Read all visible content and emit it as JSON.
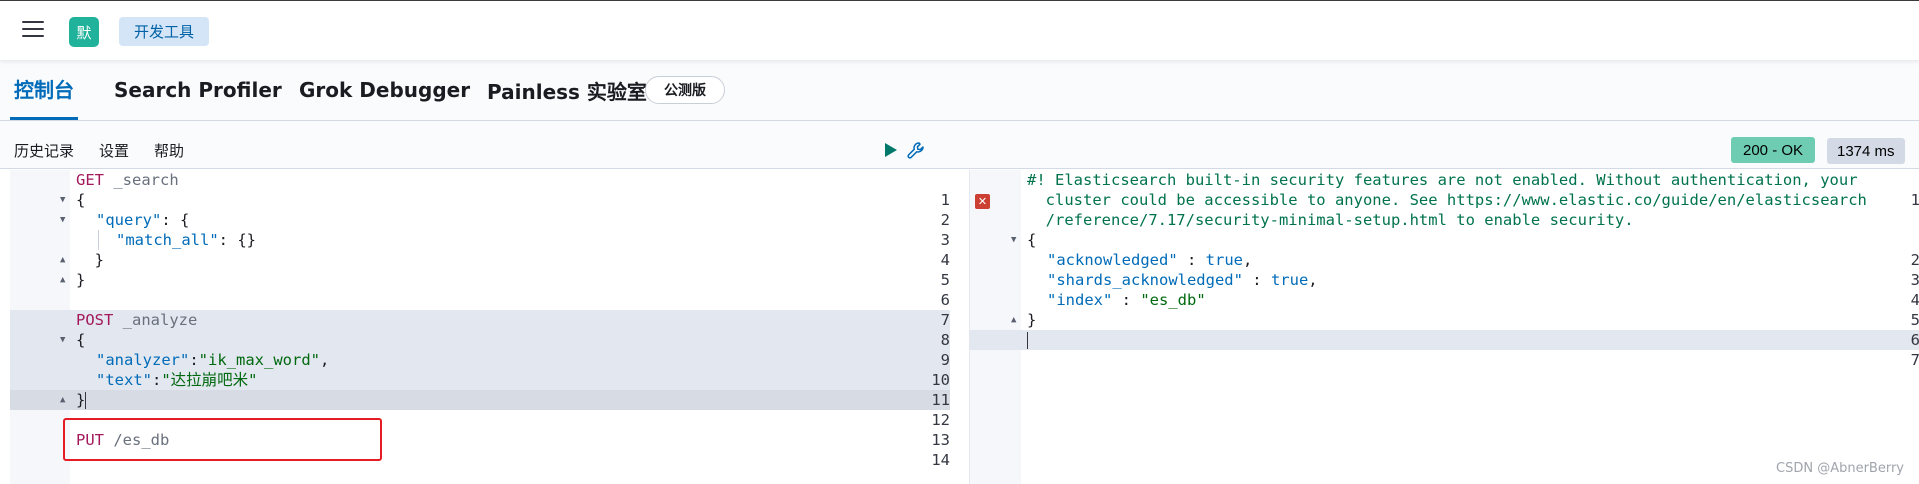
{
  "header": {
    "app_badge": "默",
    "breadcrumb": "开发工具"
  },
  "tabs": [
    {
      "label": "控制台",
      "active": true
    },
    {
      "label": "Search Profiler",
      "active": false
    },
    {
      "label": "Grok Debugger",
      "active": false
    },
    {
      "label": "Painless 实验室",
      "active": false
    }
  ],
  "beta_badge": "公测版",
  "toolbar": {
    "history": "历史记录",
    "settings": "设置",
    "help": "帮助"
  },
  "status": {
    "code": "200 - OK",
    "time": "1374 ms"
  },
  "request_editor": {
    "lines": [
      {
        "n": "1",
        "method": "GET",
        "url": " _search"
      },
      {
        "n": "2",
        "text": "{"
      },
      {
        "n": "3",
        "key": "\"query\"",
        "rest": ": {"
      },
      {
        "n": "4",
        "key": "\"match_all\"",
        "rest": ": {}"
      },
      {
        "n": "5",
        "text": "  }"
      },
      {
        "n": "6",
        "text": "}"
      },
      {
        "n": "7",
        "text": ""
      },
      {
        "n": "8",
        "method": "POST",
        "url": " _analyze"
      },
      {
        "n": "9",
        "text": "{"
      },
      {
        "n": "10",
        "key": "\"analyzer\"",
        "sep": ":",
        "str": "\"ik_max_word\"",
        "tail": ","
      },
      {
        "n": "11",
        "key": "\"text\"",
        "sep": ":",
        "str": "\"达拉崩吧米\""
      },
      {
        "n": "12",
        "text": "}"
      },
      {
        "n": "13",
        "text": ""
      },
      {
        "n": "14",
        "method": "PUT",
        "url": " /es_db"
      }
    ]
  },
  "response_editor": {
    "comment_lines": [
      "#! Elasticsearch built-in security features are not enabled. Without authentication, your",
      "  cluster could be accessible to anyone. See https://www.elastic.co/guide/en/elasticsearch",
      "  /reference/7.17/security-minimal-setup.html to enable security."
    ],
    "line_numbers": [
      "1",
      "2",
      "3",
      "4",
      "5",
      "6",
      "7"
    ],
    "body": [
      {
        "text": "{"
      },
      {
        "key": "\"acknowledged\"",
        "sep": " : ",
        "val": "true",
        "tail": ","
      },
      {
        "key": "\"shards_acknowledged\"",
        "sep": " : ",
        "val": "true",
        "tail": ","
      },
      {
        "key": "\"index\"",
        "sep": " : ",
        "str": "\"es_db\""
      },
      {
        "text": "}"
      }
    ]
  },
  "watermark": "CSDN @AbnerBerry"
}
